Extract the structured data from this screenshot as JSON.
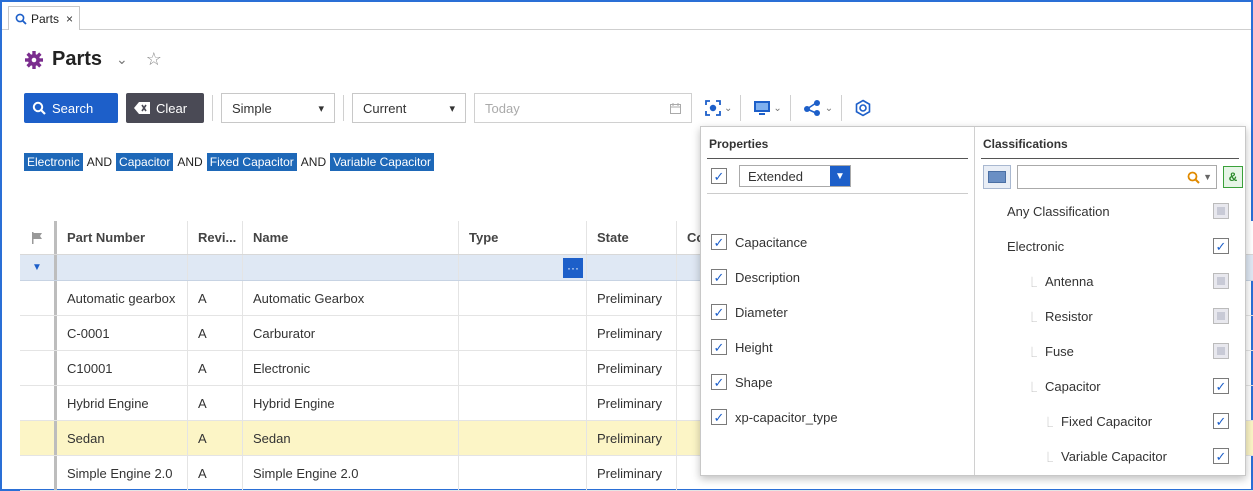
{
  "tab": {
    "label": "Parts",
    "close": "×"
  },
  "header": {
    "title": "Parts"
  },
  "toolbar": {
    "search_label": "Search",
    "clear_label": "Clear",
    "mode_value": "Simple",
    "version_value": "Current",
    "date_placeholder": "Today"
  },
  "criteria": {
    "tags": [
      "Electronic",
      "Capacitor",
      "Fixed Capacitor",
      "Variable Capacitor"
    ],
    "operator": "AND"
  },
  "grid": {
    "columns": {
      "part_number": "Part Number",
      "revision": "Revi...",
      "name": "Name",
      "type": "Type",
      "state": "State",
      "co": "Co"
    },
    "rows": [
      {
        "part_number": "Automatic gearbox",
        "revision": "A",
        "name": "Automatic Gearbox",
        "state": "Preliminary"
      },
      {
        "part_number": "C-0001",
        "revision": "A",
        "name": "Carburator",
        "state": "Preliminary"
      },
      {
        "part_number": "C10001",
        "revision": "A",
        "name": "Electronic",
        "state": "Preliminary"
      },
      {
        "part_number": "Hybrid Engine",
        "revision": "A",
        "name": "Hybrid Engine",
        "state": "Preliminary"
      },
      {
        "part_number": "Sedan",
        "revision": "A",
        "name": "Sedan",
        "state": "Preliminary"
      },
      {
        "part_number": "Simple Engine 2.0",
        "revision": "A",
        "name": "Simple Engine 2.0",
        "state": "Preliminary"
      }
    ],
    "selected_row": 4
  },
  "properties_panel": {
    "title": "Properties",
    "view_value": "Extended",
    "items": [
      {
        "label": "Capacitance",
        "checked": true
      },
      {
        "label": "Description",
        "checked": true
      },
      {
        "label": "Diameter",
        "checked": true
      },
      {
        "label": "Height",
        "checked": true
      },
      {
        "label": "Shape",
        "checked": true
      },
      {
        "label": "xp-capacitor_type",
        "checked": true
      }
    ]
  },
  "classifications_panel": {
    "title": "Classifications",
    "and_label": "&",
    "items": [
      {
        "label": "Any Classification",
        "level": 0,
        "checked": false
      },
      {
        "label": "Electronic",
        "level": 0,
        "checked": true
      },
      {
        "label": "Antenna",
        "level": 1,
        "checked": false
      },
      {
        "label": "Resistor",
        "level": 1,
        "checked": false
      },
      {
        "label": "Fuse",
        "level": 1,
        "checked": false
      },
      {
        "label": "Capacitor",
        "level": 1,
        "checked": true
      },
      {
        "label": "Fixed Capacitor",
        "level": 2,
        "checked": true
      },
      {
        "label": "Variable Capacitor",
        "level": 2,
        "checked": true
      }
    ]
  },
  "colors": {
    "accent": "#1d5fc9",
    "tag": "#1e68b8",
    "selected_row": "#fcf5c6",
    "parts_icon": "#7b2d8e"
  }
}
